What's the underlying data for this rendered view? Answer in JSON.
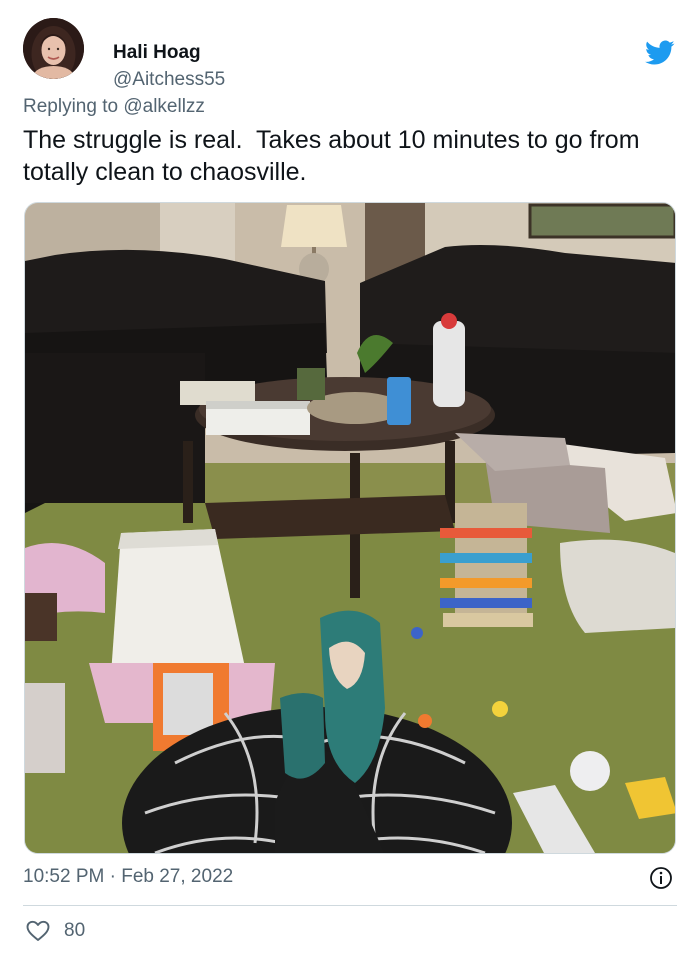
{
  "author": {
    "name": "Hali Hoag",
    "handle": "@Aitchess55"
  },
  "reply": {
    "prefix": "Replying to ",
    "mention": "@alkellzz"
  },
  "tweet": {
    "text": "The struggle is real.  Takes about 10 minutes to go from totally clean to chaosville."
  },
  "meta": {
    "time": "10:52 PM",
    "separator": " · ",
    "date": "Feb 27, 2022"
  },
  "engagement": {
    "likes": "80"
  },
  "icons": {
    "platform": "bird-icon",
    "info": "info-icon",
    "like": "heart-icon"
  },
  "colors": {
    "brand": "#1d9bf0",
    "text": "#0f1419",
    "secondary": "#536471",
    "border": "#cfd9de"
  }
}
